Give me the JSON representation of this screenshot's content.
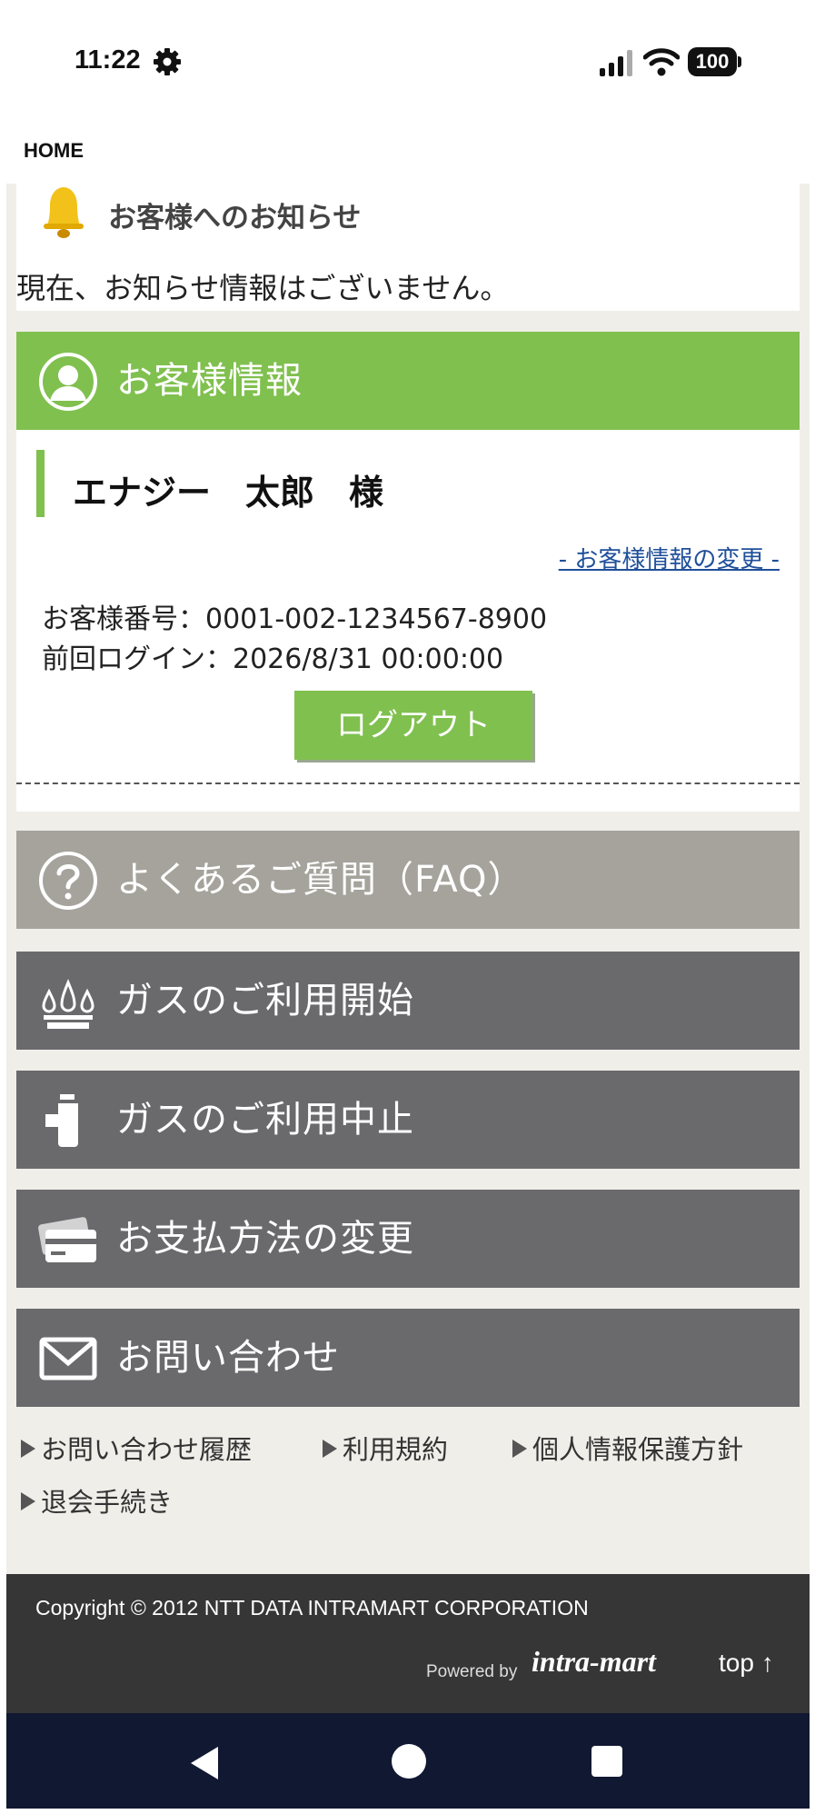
{
  "status_bar": {
    "time": "11:22",
    "battery": "100"
  },
  "header": {
    "home": "HOME"
  },
  "notice": {
    "title": "お客様へのお知らせ",
    "body": "現在、お知らせ情報はございません。"
  },
  "customer": {
    "header": "お客様情報",
    "name": "エナジー　太郎　様",
    "edit_link": "- お客様情報の変更 -",
    "number": "お客様番号：0001-002-1234567-8900",
    "last_login": "前回ログイン：2026/8/31 00:00:00",
    "logout": "ログアウト"
  },
  "menu": {
    "faq": "よくあるご質問（FAQ）",
    "gas_start": "ガスのご利用開始",
    "gas_stop": "ガスのご利用中止",
    "payment": "お支払方法の変更",
    "contact": "お問い合わせ"
  },
  "footer_links": {
    "history": "お問い合わせ履歴",
    "terms": "利用規約",
    "privacy": "個人情報保護方針",
    "withdraw": "退会手続き"
  },
  "footer": {
    "copyright": "Copyright © 2012 NTT DATA INTRAMART CORPORATION",
    "powered_by": "Powered by",
    "logo": "intra-mart",
    "top": "top ↑"
  },
  "colors": {
    "accent_green": "#80c04f",
    "faq_gray": "#a5a39c",
    "menu_gray": "#6a6a6c",
    "link_blue": "#1f4f9a"
  }
}
